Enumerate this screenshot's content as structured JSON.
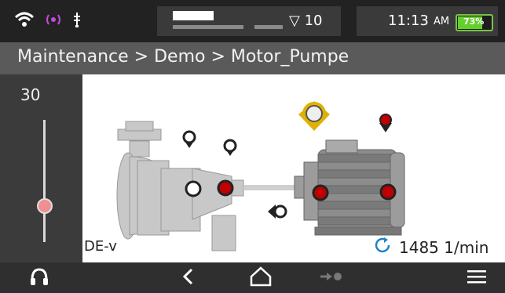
{
  "status": {
    "signal_count": "▽ 10",
    "time": "11:13",
    "ampm": "AM",
    "battery_percent": "73%",
    "battery_level": 0.73
  },
  "breadcrumb": "Maintenance > Demo > Motor_Pumpe",
  "zoom": {
    "value": "30",
    "level": 0.35
  },
  "sensor_label": "DE-v",
  "speed": "1485 1/min",
  "colors": {
    "accent_red": "#c00000",
    "highlight_yellow": "#e0b100",
    "battery_green": "#63d12c"
  }
}
